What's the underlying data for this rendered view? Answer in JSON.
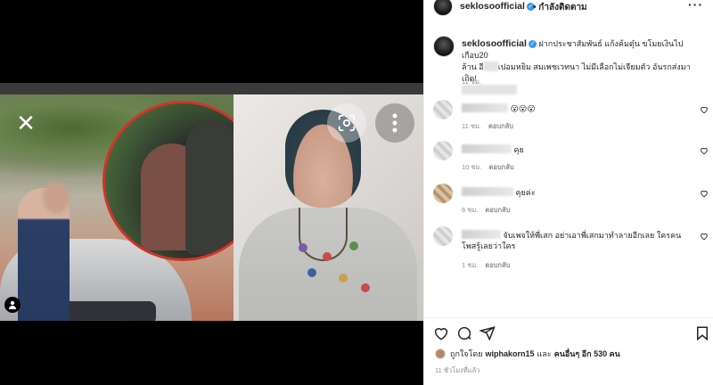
{
  "header": {
    "username": "seklosoofficial",
    "verified": true,
    "follow_status": "• กำลังติดตาม",
    "more_glyph": "···"
  },
  "caption": {
    "username": "seklosoofficial",
    "text_line1": "ฝากประชาสัมพันธ์ แก้งค้มตุ๋น ขโมยเงินไปเกือบ20",
    "text_line2a": "ล้าน อี",
    "text_line2b": "เปอมหยิม สมเพชเวทนา ไม่มีเลือกไม่เจียมตัว อันรกส่งมาเกิด!",
    "time": "11 ชม."
  },
  "comments": [
    {
      "text": "😮😮😮",
      "time": "11 ชม.",
      "reply": "ตอบกลับ",
      "likes_text": ""
    },
    {
      "text": "คุย",
      "time": "10 ชม.",
      "reply": "ตอบกลับ",
      "likes_text": ""
    },
    {
      "text": "คุยค่ะ",
      "time": "6 ชม.",
      "reply": "ตอบกลับ",
      "likes_text": ""
    },
    {
      "text": "จับเพจให้พี่เสก อย่าเอาพี่เสกมาทำลายอีกเลย ใครคน",
      "text2": "โพสรู้เลยว่าใคร",
      "time": "1 ชม.",
      "reply": "ตอบกลับ",
      "likes_text": ""
    }
  ],
  "likes": {
    "prefix": "ถูกใจโดย",
    "user": "wiphakorn15",
    "middle": "และ",
    "others": "คนอื่นๆ อีก 530 คน"
  },
  "posted": "11 ชั่วโมงที่แล้ว",
  "icons": {
    "close": "close-icon",
    "scan": "visual-search-icon",
    "more": "more-vertical-icon",
    "tag": "user-tag-icon",
    "like": "heart-icon",
    "comment": "comment-icon",
    "share": "send-icon",
    "save": "bookmark-icon"
  },
  "colors": {
    "verified": "#3897f0",
    "inset_border": "#d0342c",
    "meta_text": "#8e8e8e"
  }
}
